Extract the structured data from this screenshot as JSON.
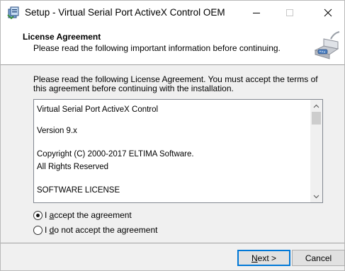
{
  "window": {
    "title": "Setup - Virtual Serial Port ActiveX Control OEM"
  },
  "header": {
    "title": "License Agreement",
    "subtitle": "Please read the following important information before continuing."
  },
  "intro": {
    "text": "Please read the following License Agreement. You must accept the terms of this agreement before continuing with the installation."
  },
  "license": {
    "lines": [
      "Virtual Serial Port ActiveX Control",
      "Version 9.x",
      "Copyright (C) 2000-2017 ELTIMA Software.",
      "All Rights Reserved",
      "SOFTWARE LICENSE"
    ]
  },
  "options": {
    "accept": {
      "label_pre": "I ",
      "label_key": "a",
      "label_post": "ccept the agreement",
      "selected": true
    },
    "decline": {
      "label_pre": "I ",
      "label_key": "d",
      "label_post": "o not accept the agreement",
      "selected": false
    }
  },
  "buttons": {
    "next": {
      "key": "N",
      "rest": "ext >"
    },
    "cancel": "Cancel"
  },
  "colors": {
    "accent": "#0078d7",
    "window_bg": "#f0f0f0"
  }
}
